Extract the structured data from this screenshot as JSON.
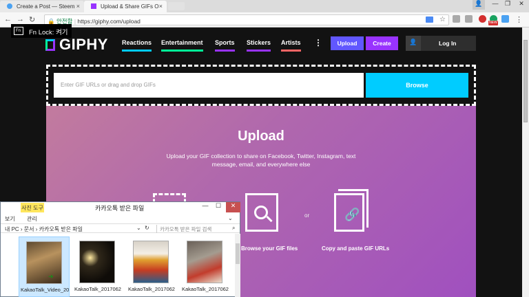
{
  "browser": {
    "tabs": [
      {
        "title": "Create a Post — Steem"
      },
      {
        "title": "Upload & Share GIFs O"
      }
    ],
    "secure_label": "안전함",
    "url": "https://giphy.com/upload",
    "ext_badge": "NEW"
  },
  "fn_lock": {
    "box": "Fn",
    "label": "Fn Lock: 켜기"
  },
  "giphy": {
    "logo": "GIPHY",
    "nav": [
      "Reactions",
      "Entertainment",
      "Sports",
      "Stickers",
      "Artists"
    ],
    "more": "⋮",
    "upload_btn": "Upload",
    "create_btn": "Create",
    "login_btn": "Log In",
    "url_placeholder": "Enter GIF URLs or drag and drop GIFs",
    "browse_btn": "Browse",
    "upload_title": "Upload",
    "upload_desc": "Upload your GIF collection to share on Facebook, Twitter, Instagram, text message, email, and everywhere else",
    "or": "or",
    "browse_label": "Browse your GIF files",
    "paste_label": "Copy and paste GIF URLs"
  },
  "explorer": {
    "ribbon_tab": "사진 도구",
    "title": "카카오톡 받은 파일",
    "menu": [
      "보기",
      "관리"
    ],
    "path": "내 PC  ›  문서  ›  카카오톡 받은 파일",
    "search_placeholder": "카카오톡 받은 파일 검색",
    "files": [
      {
        "name": "KakaoTalk_Video_20"
      },
      {
        "name": "KakaoTalk_2017062"
      },
      {
        "name": "KakaoTalk_2017062"
      },
      {
        "name": "KakaoTalk_2017062"
      }
    ]
  },
  "colors": {
    "upload": "#6157ff",
    "create": "#9933ff",
    "browse": "#00ccff"
  }
}
